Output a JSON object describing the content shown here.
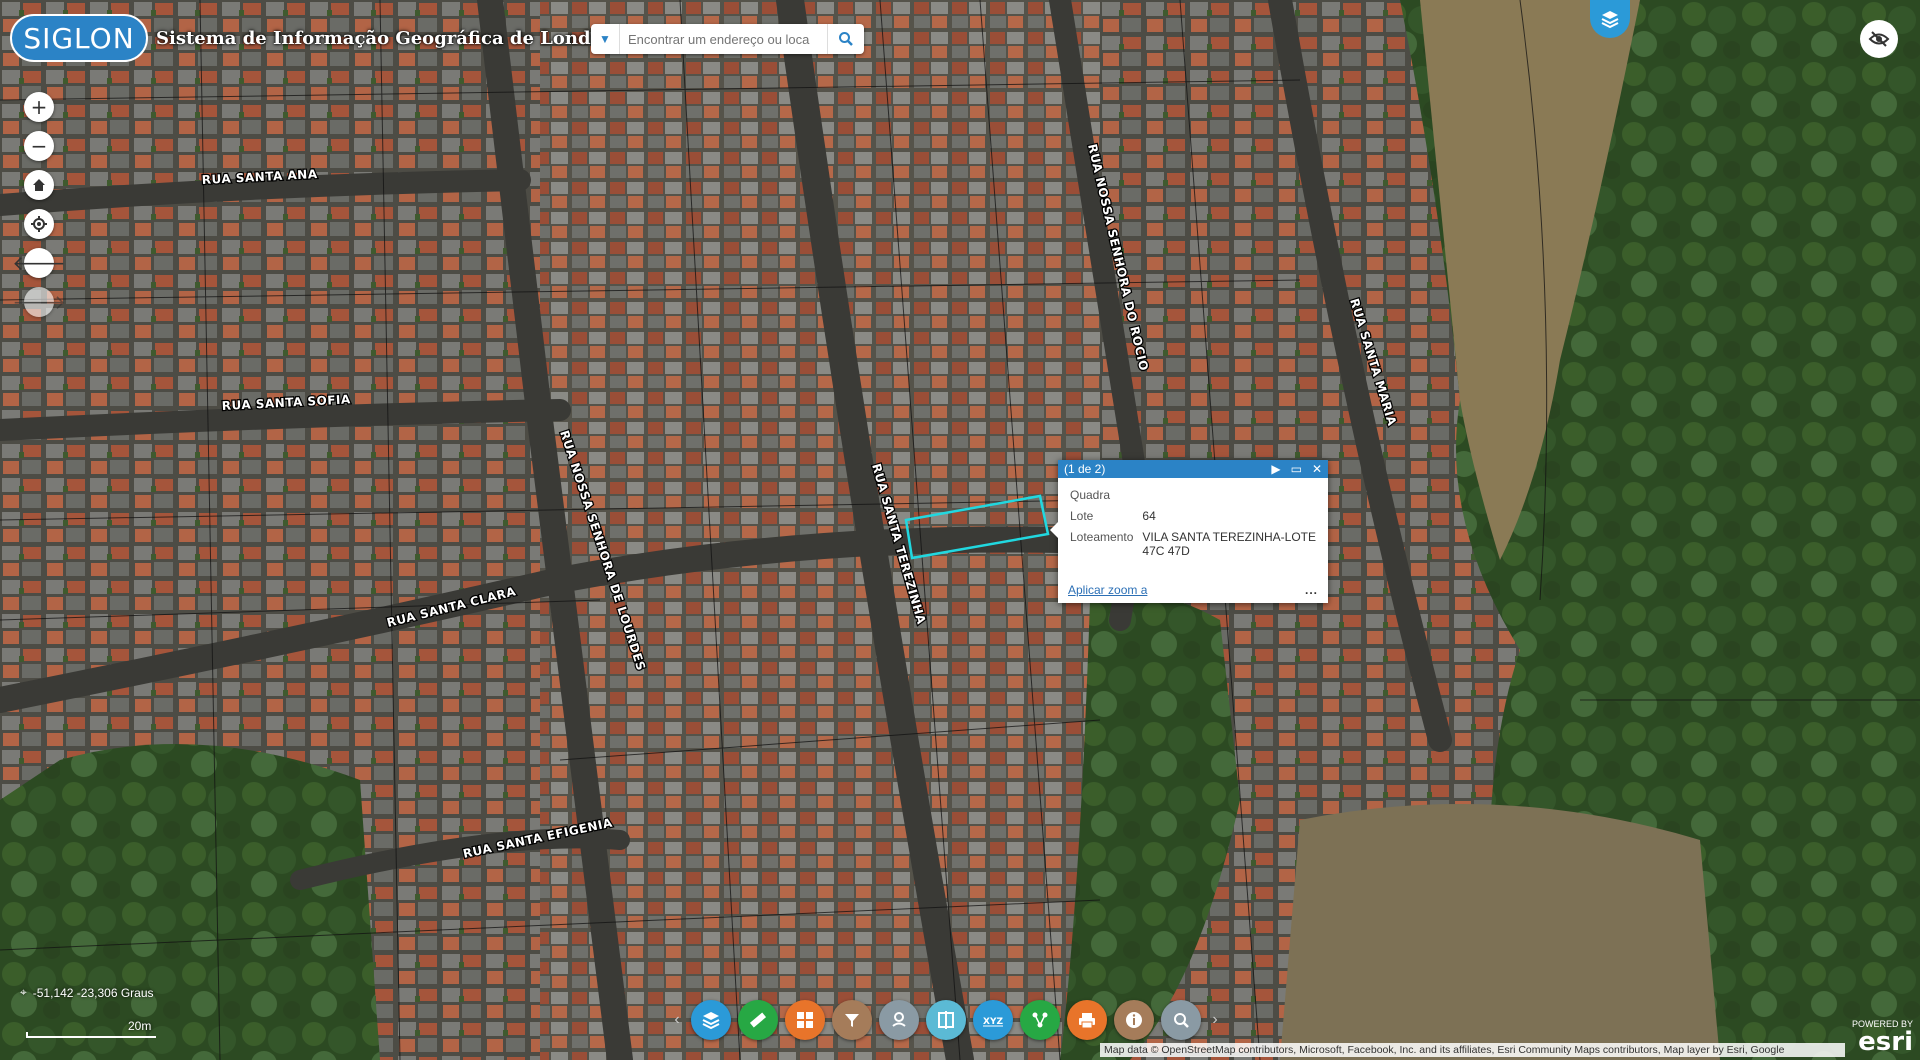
{
  "header": {
    "logo_text": "SIGLON",
    "title": "Sistema de Informação Geográfica de Londrina"
  },
  "search": {
    "placeholder": "Encontrar um endereço ou loca"
  },
  "streets": [
    "RUA SANTA ANA",
    "RUA SANTA SOFIA",
    "RUA SANTA CLARA",
    "RUA SANTA EFIGENIA",
    "RUA NOSSA SENHORA DE LOURDES",
    "RUA SANTA TEREZINHA",
    "RUA NOSSA SENHORA DO ROCIO",
    "RUA SANTA MARIA"
  ],
  "popup": {
    "counter": "(1 de 2)",
    "fields": [
      {
        "label": "Quadra",
        "value": ""
      },
      {
        "label": "Lote",
        "value": "64"
      },
      {
        "label": "Loteamento",
        "value": "VILA SANTA TEREZINHA-LOTE 47C 47D"
      }
    ],
    "zoom_link": "Aplicar zoom a",
    "more": "..."
  },
  "status": {
    "coordinates": "-51,142 -23,306 Graus",
    "scale_label": "20m"
  },
  "attribution": "Map data © OpenStreetMap contributors, Microsoft, Facebook, Inc. and its affiliates, Esri Community Maps contributors, Map layer by Esri, Google",
  "esri": {
    "powered_by": "POWERED BY",
    "brand": "esri"
  },
  "toolbar": {
    "tools": [
      {
        "icon": "layers-icon",
        "color": "#2b9ad8"
      },
      {
        "icon": "ruler-icon",
        "color": "#27a844"
      },
      {
        "icon": "grid-icon",
        "color": "#e8742a"
      },
      {
        "icon": "filter-icon",
        "color": "#a57c5a"
      },
      {
        "icon": "route-icon",
        "color": "#8a9aa4"
      },
      {
        "icon": "swipe-icon",
        "color": "#5bbad5"
      },
      {
        "icon": "xyz-icon",
        "color": "#2b9ad8"
      },
      {
        "icon": "share-icon",
        "color": "#27a844"
      },
      {
        "icon": "print-icon",
        "color": "#e8742a"
      },
      {
        "icon": "info-icon",
        "color": "#a57c5a"
      },
      {
        "icon": "search-map-icon",
        "color": "#8a9aa4"
      }
    ]
  },
  "colors": {
    "accent": "#2b83c6",
    "highlight": "#21d8e0"
  }
}
